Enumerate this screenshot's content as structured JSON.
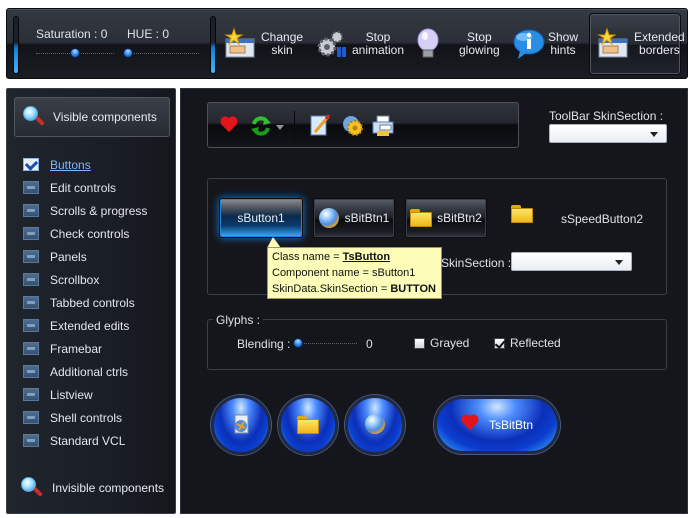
{
  "topbar": {
    "saturation_label": "Saturation :",
    "saturation_value": "0",
    "hue_label": "HUE :",
    "hue_value": "0",
    "saturation_slider_fraction": 0.5,
    "hue_slider_fraction": 0.0,
    "buttons": [
      {
        "label_line1": "Change",
        "label_line2": "skin",
        "icon": "window-star-icon"
      },
      {
        "label_line1": "Stop",
        "label_line2": "animation",
        "icon": "gears-icon"
      },
      {
        "label_line1": "Stop",
        "label_line2": "glowing",
        "icon": "lightbulb-icon"
      },
      {
        "label_line1": "Show",
        "label_line2": "hints",
        "icon": "info-bubble-icon"
      },
      {
        "label_line1": "Extended",
        "label_line2": "borders",
        "icon": "window-star-icon",
        "active": true
      }
    ]
  },
  "sidebar": {
    "header_label": "Visible components",
    "items": [
      {
        "label": "Buttons",
        "selected": true
      },
      {
        "label": "Edit controls"
      },
      {
        "label": "Scrolls & progress"
      },
      {
        "label": "Check controls"
      },
      {
        "label": "Panels"
      },
      {
        "label": "Scrollbox"
      },
      {
        "label": "Tabbed controls"
      },
      {
        "label": "Extended edits"
      },
      {
        "label": "Framebar"
      },
      {
        "label": "Additional ctrls"
      },
      {
        "label": "Listview"
      },
      {
        "label": "Shell controls"
      },
      {
        "label": "Standard VCL"
      }
    ],
    "footer_label": "Invisible components"
  },
  "main": {
    "toolbar_icons": [
      "heart-icon",
      "refresh-icon",
      "dropdown-arrow-icon",
      "edit-document-icon",
      "settings-globe-icon",
      "fax-icon"
    ],
    "toolbar_skin_label": "ToolBar SkinSection :",
    "toolbar_skin_value": "",
    "buttons": {
      "sbutton1": "sButton1",
      "sbitbtn1": "sBitBtn1",
      "sbitbtn2": "sBitBtn2",
      "sspeedbutton2": "sSpeedButton2"
    },
    "button_skin_label": "SkinSection :",
    "button_skin_value": "",
    "hint": {
      "line1_prefix": "Class name = ",
      "line1_value": "TsButton",
      "line2": "Component name = sButton1",
      "line3_prefix": "SkinData.SkinSection = ",
      "line3_value": "BUTTON"
    },
    "glyphs": {
      "group_label": "Glyphs :",
      "blending_label": "Blending :",
      "blending_value": "0",
      "blending_fraction": 0.0,
      "grayed_label": "Grayed",
      "grayed_checked": false,
      "reflected_label": "Reflected",
      "reflected_checked": true
    },
    "round_buttons": {
      "pill_label": "TsBitBtn"
    }
  }
}
